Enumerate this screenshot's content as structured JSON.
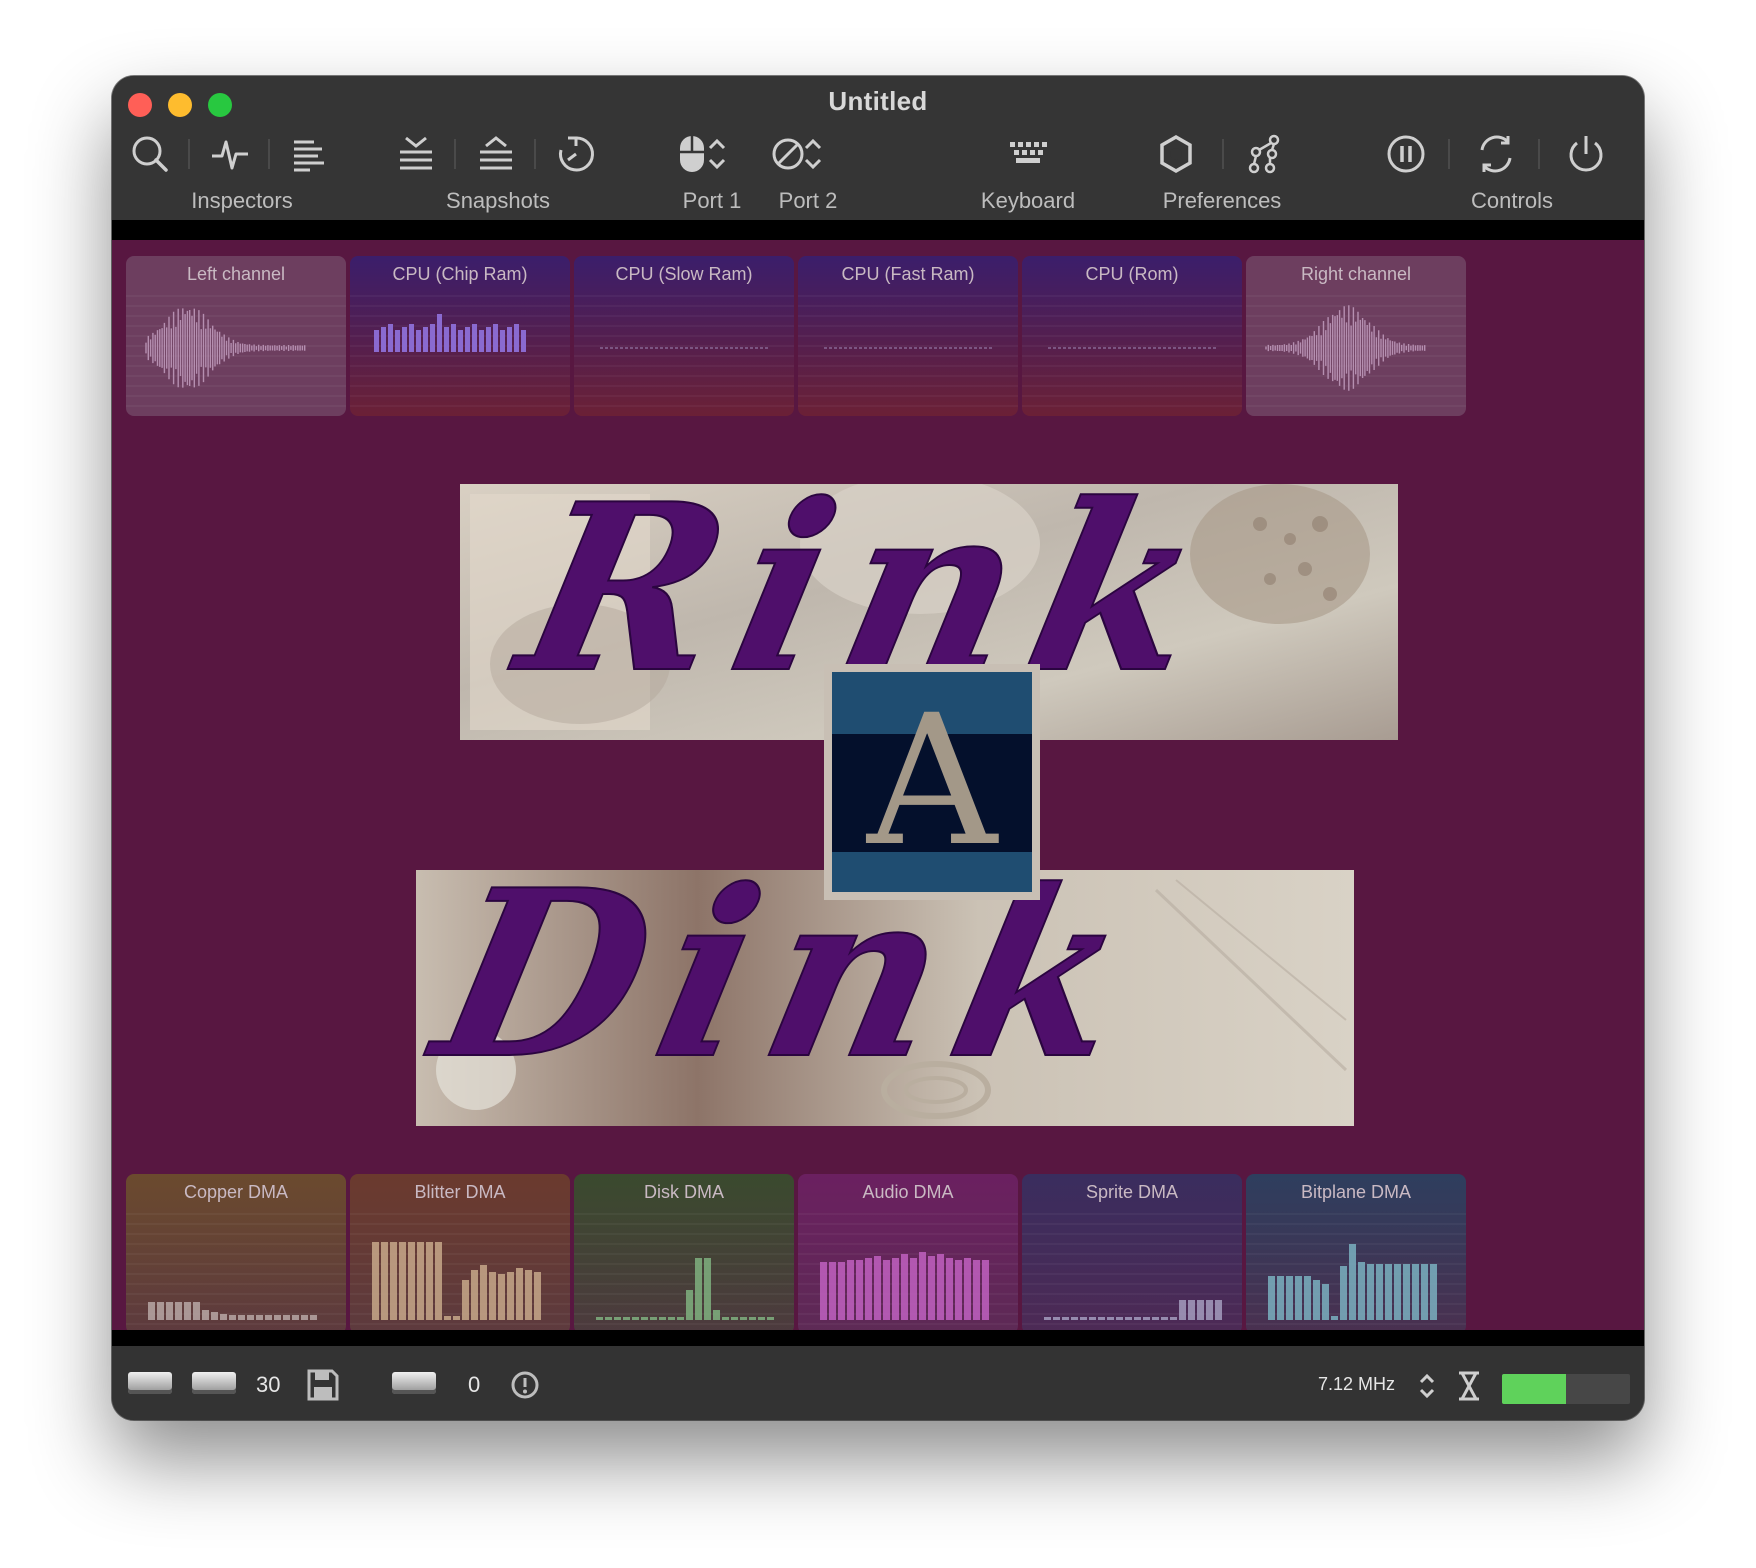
{
  "window": {
    "title": "Untitled"
  },
  "toolbar": {
    "inspectors_label": "Inspectors",
    "snapshots_label": "Snapshots",
    "port1_label": "Port 1",
    "port2_label": "Port 2",
    "keyboard_label": "Keyboard",
    "preferences_label": "Preferences",
    "controls_label": "Controls",
    "icons": [
      "search-icon",
      "waveform-icon",
      "align-left-icon",
      "snapshot-save-icon",
      "snapshot-restore-icon",
      "rewind-icon",
      "mouse-icon",
      "none-icon",
      "keyboard-icon",
      "gear-icon",
      "settings-tree-icon",
      "pause-icon",
      "reset-icon",
      "power-icon"
    ]
  },
  "monitors_top": [
    {
      "label": "Left channel",
      "kind": "wave"
    },
    {
      "label": "CPU (Chip Ram)",
      "kind": "bars"
    },
    {
      "label": "CPU (Slow Ram)",
      "kind": "flat"
    },
    {
      "label": "CPU (Fast Ram)",
      "kind": "flat"
    },
    {
      "label": "CPU (Rom)",
      "kind": "flat"
    },
    {
      "label": "Right channel",
      "kind": "wave"
    }
  ],
  "monitors_bottom": [
    {
      "label": "Copper DMA"
    },
    {
      "label": "Blitter DMA"
    },
    {
      "label": "Disk DMA"
    },
    {
      "label": "Audio DMA"
    },
    {
      "label": "Sprite DMA"
    },
    {
      "label": "Bitplane DMA"
    }
  ],
  "screen_art": {
    "top_word": "Rink",
    "middle_letter": "A",
    "bottom_word": "Dink"
  },
  "status": {
    "df_counter": "30",
    "df2_counter": "0",
    "clock_speed": "7.12 MHz",
    "speed_level_percent": 50,
    "colors": {
      "speed_fill": "#5fd25b",
      "screen_bg": "#581741"
    }
  }
}
